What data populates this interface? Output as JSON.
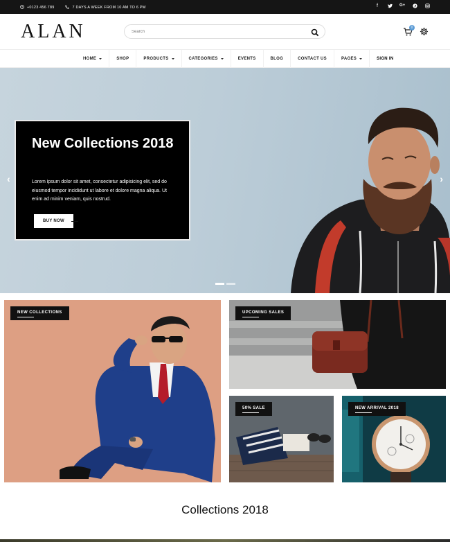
{
  "topbar": {
    "phone": "+0123 456 789",
    "hours": "7 DAYS A WEEK FROM 10 AM TO 6 PM",
    "socials": [
      "facebook-icon",
      "twitter-icon",
      "google-plus-icon",
      "pinterest-icon",
      "instagram-icon"
    ]
  },
  "header": {
    "logo": "ALAN",
    "search_placeholder": "Search",
    "cart_count": "0"
  },
  "nav": {
    "items": [
      {
        "label": "HOME",
        "dropdown": true
      },
      {
        "label": "SHOP",
        "dropdown": false
      },
      {
        "label": "PRODUCTS",
        "dropdown": true
      },
      {
        "label": "CATEGORIES",
        "dropdown": true
      },
      {
        "label": "EVENTS",
        "dropdown": false
      },
      {
        "label": "BLOG",
        "dropdown": false
      },
      {
        "label": "CONTACT US",
        "dropdown": false
      },
      {
        "label": "PAGES",
        "dropdown": true
      },
      {
        "label": "SIGN IN",
        "dropdown": false
      }
    ]
  },
  "hero": {
    "title": "New Collections 2018",
    "text": "Lorem ipsum dolor sit amet, consectetur adipisicing elit, sed do eiusmod tempor incididunt ut labore et dolore magna aliqua. Ut enim ad minim veniam, quis nostrud.",
    "button": "BUY NOW",
    "slides": 2,
    "active_slide": 1
  },
  "banners": {
    "new_collections": "NEW COLLECTIONS",
    "upcoming_sales": "UPCOMING SALES",
    "sale": "50% SALE",
    "new_arrival": "NEW ARRIVAL 2018"
  },
  "collections_title": "Collections 2018",
  "colors": {
    "topbar_bg": "#151515",
    "accent_badge": "#5b9bd5",
    "hero_bg": "#c6d4dd",
    "banner_peach": "#dd9f83"
  }
}
